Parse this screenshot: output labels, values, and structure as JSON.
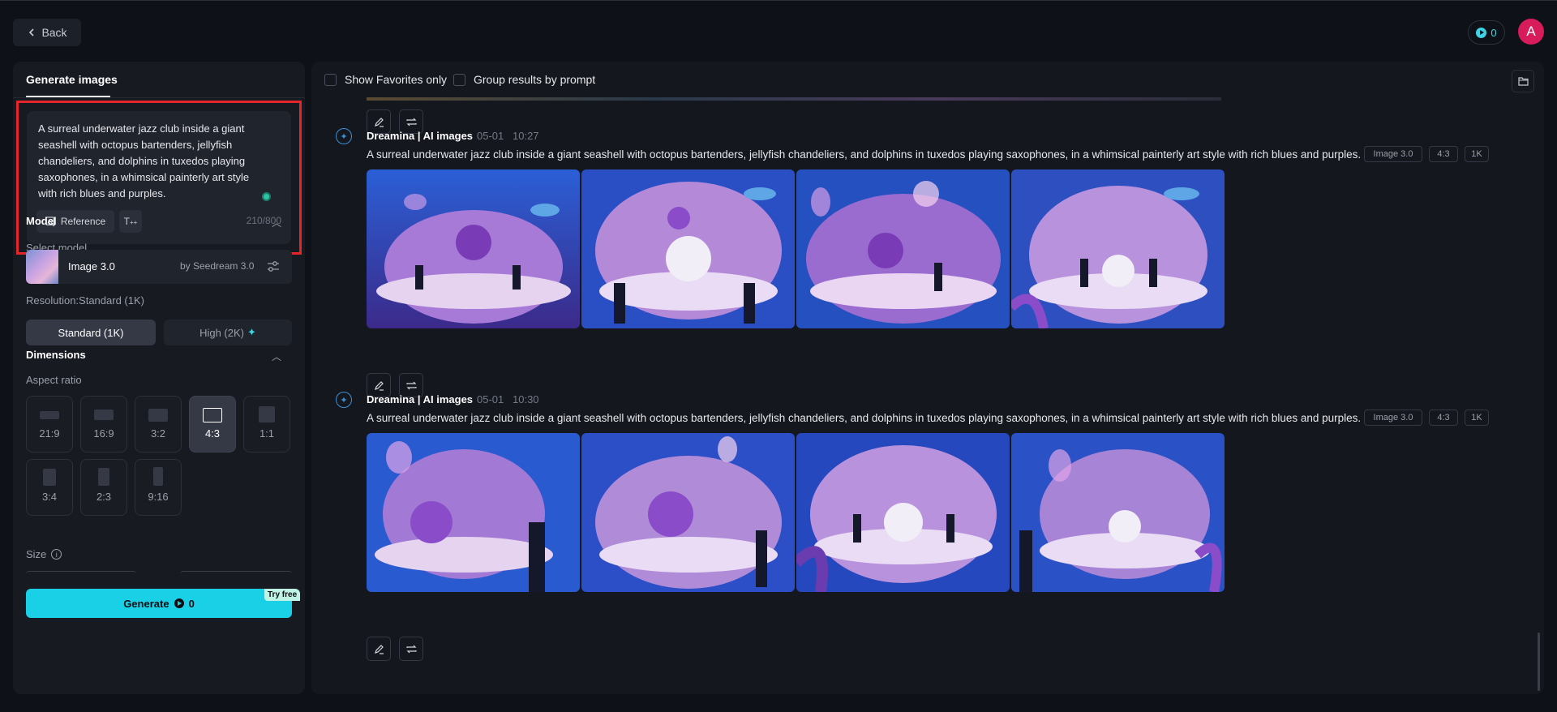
{
  "topbar": {
    "back_label": "Back",
    "credits": "0",
    "avatar_initial": "A"
  },
  "left": {
    "tab_title": "Generate images",
    "prompt_text": "A surreal underwater jazz club inside a giant seashell with octopus bartenders, jellyfish chandeliers, and dolphins in tuxedos playing saxophones, in a whimsical painterly art style with rich blues and purples.",
    "reference_label": "Reference",
    "char_count": "210/800",
    "model_section": "Model",
    "select_model_label": "Select model",
    "model_name": "Image 3.0",
    "model_by": "by Seedream 3.0",
    "resolution_label": "Resolution:Standard (1K)",
    "res_standard": "Standard (1K)",
    "res_high": "High (2K)",
    "dimensions_section": "Dimensions",
    "aspect_label": "Aspect ratio",
    "aspects": [
      "21:9",
      "16:9",
      "3:2",
      "4:3",
      "1:1",
      "3:4",
      "2:3",
      "9:16"
    ],
    "selected_aspect": "4:3",
    "size_label": "Size",
    "generate_label": "Generate",
    "generate_cost": "0",
    "try_free": "Try free"
  },
  "right": {
    "show_favorites": "Show Favorites only",
    "group_by_prompt": "Group results by prompt",
    "groups": [
      {
        "author": "Dreamina | AI images",
        "date": "05-01",
        "time": "10:27",
        "prompt": "A surreal underwater jazz club inside a giant seashell with octopus bartenders, jellyfish chandeliers, and dolphins in tuxedos playing saxophones, in a whimsical painterly art style with rich blues and purples.",
        "tags": [
          "Image 3.0",
          "4:3",
          "1K"
        ]
      },
      {
        "author": "Dreamina | AI images",
        "date": "05-01",
        "time": "10:30",
        "prompt": "A surreal underwater jazz club inside a giant seashell with octopus bartenders, jellyfish chandeliers, and dolphins in tuxedos playing saxophones, in a whimsical painterly art style with rich blues and purples.",
        "tags": [
          "Image 3.0",
          "4:3",
          "1K"
        ]
      }
    ]
  }
}
